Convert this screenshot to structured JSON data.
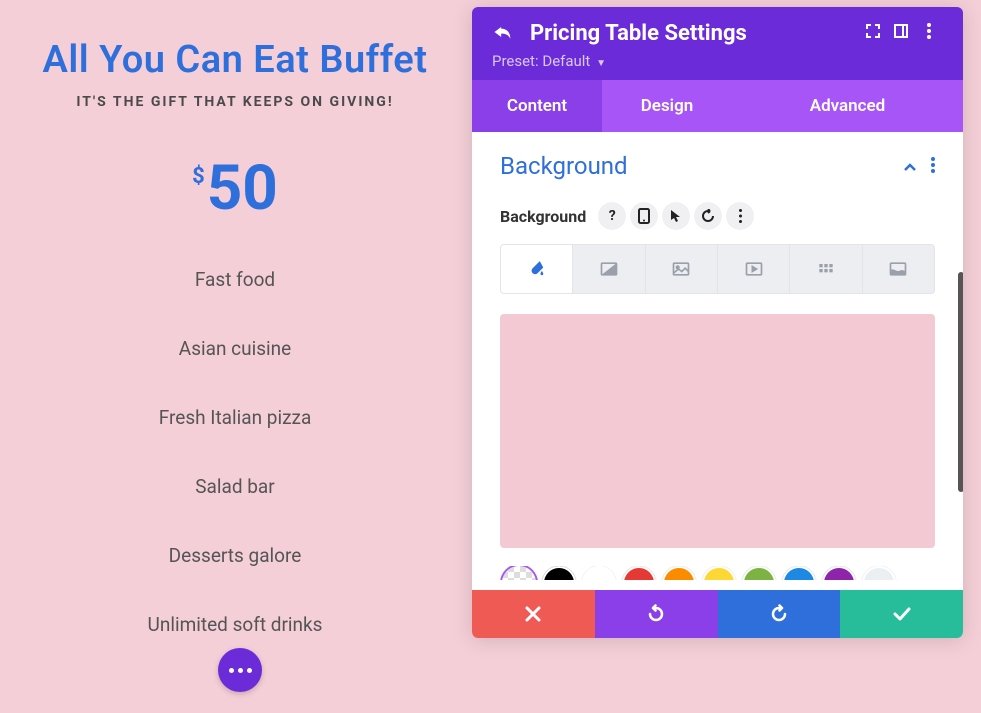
{
  "pricing": {
    "title": "All You Can Eat Buffet",
    "subtitle": "IT'S THE GIFT THAT KEEPS ON GIVING!",
    "currency": "$",
    "price": "50",
    "features": [
      "Fast food",
      "Asian cuisine",
      "Fresh Italian pizza",
      "Salad bar",
      "Desserts galore",
      "Unlimited soft drinks"
    ]
  },
  "modal": {
    "title": "Pricing Table Settings",
    "preset_label": "Preset:",
    "preset_value": "Default",
    "tabs": {
      "content": "Content",
      "design": "Design",
      "advanced": "Advanced"
    },
    "section_title": "Background",
    "property_label": "Background",
    "preview_color": "#f3c9d4",
    "swatches": [
      "transparent",
      "#000000",
      "#ffffff",
      "#e53935",
      "#fb8c00",
      "#fdd835",
      "#7cb342",
      "#1e88e5",
      "#8e24aa",
      "#eceff1"
    ]
  }
}
